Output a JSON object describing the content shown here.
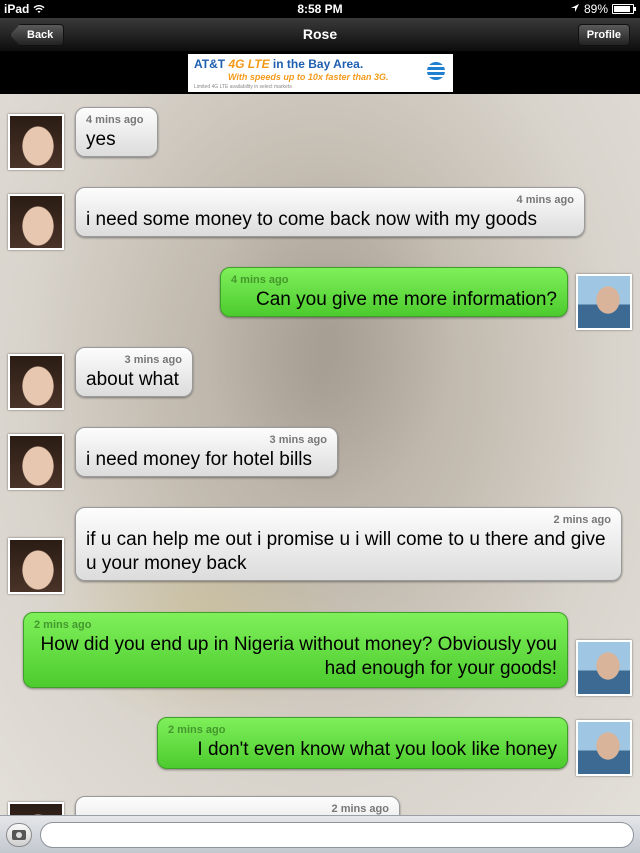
{
  "status_bar": {
    "device": "iPad",
    "time": "8:58 PM",
    "battery": "89%",
    "battery_level": 0.89
  },
  "nav": {
    "back_label": "Back",
    "title": "Rose",
    "profile_label": "Profile"
  },
  "ad": {
    "brand": "AT&T",
    "badge": "4G LTE",
    "headline": "in the Bay Area.",
    "tagline": "With speeds up to 10x faster than 3G.",
    "fine_print": "Limited 4G LTE availability in select markets"
  },
  "messages": [
    {
      "sender": "Rose",
      "time": "4 mins ago",
      "text": "yes"
    },
    {
      "sender": "Rose",
      "time": "4 mins ago",
      "text": "i need some money to come back now with my goods"
    },
    {
      "sender": "me",
      "time": "4 mins ago",
      "text": "Can you give me more information?"
    },
    {
      "sender": "Rose",
      "time": "3 mins ago",
      "text": "about what"
    },
    {
      "sender": "Rose",
      "time": "3 mins ago",
      "text": "i need money for hotel bills"
    },
    {
      "sender": "Rose",
      "time": "2 mins ago",
      "text": "if u can help me out i promise u i will come to u there and give u your money back"
    },
    {
      "sender": "me",
      "time": "2 mins ago",
      "text": "How did you end up in Nigeria without money? Obviously you had enough for your goods!"
    },
    {
      "sender": "me",
      "time": "2 mins ago",
      "text": "I don't even know what you look like honey"
    },
    {
      "sender": "Rose",
      "time": "2 mins ago",
      "text": ""
    }
  ],
  "input": {
    "placeholder": ""
  },
  "icons": {
    "wifi": "wifi-icon",
    "location": "location-arrow-icon",
    "battery": "battery-icon",
    "camera": "camera-icon"
  },
  "colors": {
    "incoming_bubble": "#e8e8e8",
    "outgoing_bubble": "#5fdc3c",
    "nav_bar": "#1a1a1a"
  }
}
